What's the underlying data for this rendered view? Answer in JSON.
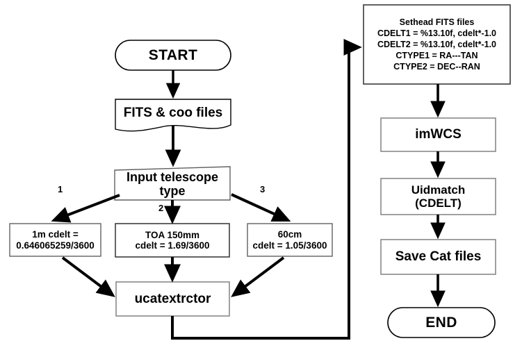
{
  "diagram": {
    "title": "FITS astrometry calibration pipeline flowchart",
    "colors": {
      "stroke": "#000000",
      "box_stroke": "#808080",
      "fill": "#ffffff",
      "text": "#000000"
    },
    "nodes": {
      "start": {
        "label": "START",
        "shape": "terminator"
      },
      "fits_files": {
        "label": "FITS & coo files",
        "shape": "document"
      },
      "input_type": {
        "label": "Input telescope\ntype",
        "shape": "process"
      },
      "branch_1m": {
        "label": "1m        cdelt =\n0.646065259/3600",
        "shape": "process"
      },
      "branch_toa": {
        "label": "TOA 150mm\ncdelt = 1.69/3600",
        "shape": "process"
      },
      "branch_60cm": {
        "label": "60cm\ncdelt = 1.05/3600",
        "shape": "process"
      },
      "ucatextrctor": {
        "label": "ucatextrctor",
        "shape": "process"
      },
      "sethead": {
        "label": "Sethead FITS files\nCDELT1 = %13.10f, cdelt*-1.0\nCDELT2 = %13.10f, cdelt*-1.0\nCTYPE1 = RA---TAN\nCTYPE2 = DEC--RAN",
        "shape": "process"
      },
      "imwcs": {
        "label": "imWCS",
        "shape": "process"
      },
      "uidmatch": {
        "label": "Uidmatch\n(CDELT)",
        "shape": "process"
      },
      "save_cat": {
        "label": "Save Cat files",
        "shape": "process"
      },
      "end": {
        "label": "END",
        "shape": "terminator"
      }
    },
    "edge_labels": {
      "branch_one": "1",
      "branch_two": "2",
      "branch_three": "3"
    }
  }
}
